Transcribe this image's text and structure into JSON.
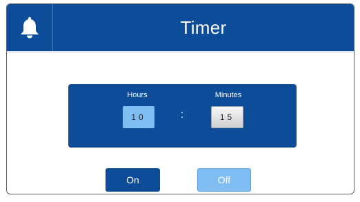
{
  "header": {
    "title": "Timer",
    "bell_icon": "bell-icon"
  },
  "timer": {
    "hours_label": "Hours",
    "minutes_label": "Minutes",
    "hours_value": "10",
    "minutes_value": "15",
    "separator": ":"
  },
  "controls": {
    "on_label": "On",
    "off_label": "Off"
  },
  "colors": {
    "primary": "#0c4c98",
    "accent_light": "#80bdf3",
    "inactive_field": "#e0e0e0"
  }
}
